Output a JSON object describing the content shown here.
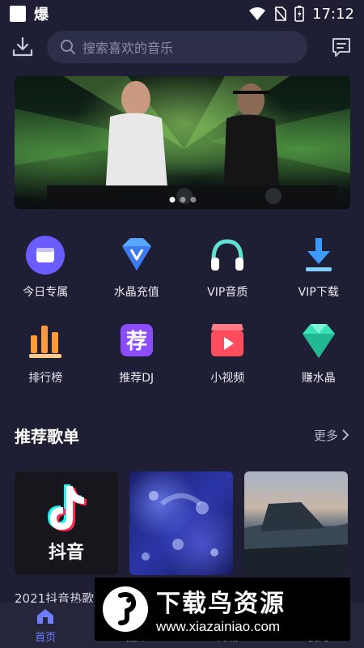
{
  "status_bar": {
    "app_text": "爆",
    "time": "17:12"
  },
  "search": {
    "placeholder": "搜索喜欢的音乐"
  },
  "banner": {
    "slides": 3,
    "active_slide": 1
  },
  "grid": [
    {
      "label": "今日专属",
      "icon": "today-special-icon"
    },
    {
      "label": "水晶充值",
      "icon": "crystal-recharge-icon"
    },
    {
      "label": "VIP音质",
      "icon": "headphones-icon"
    },
    {
      "label": "VIP下载",
      "icon": "download-icon"
    },
    {
      "label": "排行榜",
      "icon": "chart-bars-icon"
    },
    {
      "label": "推荐DJ",
      "icon": "recommend-dj-icon"
    },
    {
      "label": "小视频",
      "icon": "video-icon"
    },
    {
      "label": "赚水晶",
      "icon": "diamond-icon"
    }
  ],
  "section": {
    "title": "推荐歌单",
    "more": "更多"
  },
  "cards": [
    {
      "logo_text": "抖音"
    },
    {},
    {}
  ],
  "card_title_visible": "2021抖音热歌",
  "bottom_nav": [
    {
      "label": "首页",
      "active": true
    },
    {
      "label": "曲库",
      "active": false
    },
    {
      "label": "商城",
      "active": false
    },
    {
      "label": "我的",
      "active": false
    }
  ],
  "watermark": {
    "title": "下载鸟资源",
    "url": "www.xiazainiao.com"
  },
  "colors": {
    "background": "#1e1f35",
    "accent": "#6f7dff"
  }
}
